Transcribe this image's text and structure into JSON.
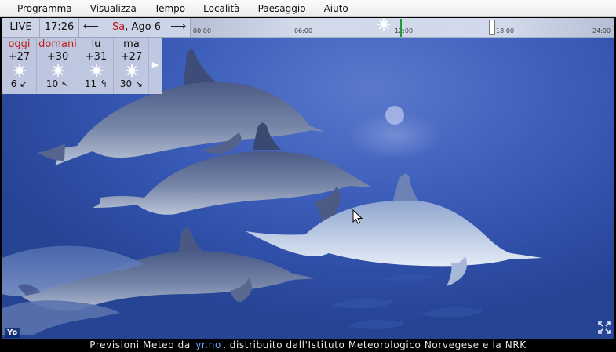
{
  "menu": [
    "Programma",
    "Visualizza",
    "Tempo",
    "Località",
    "Paesaggio",
    "Aiuto"
  ],
  "timebar": {
    "live_label": "LIVE",
    "clock": "17:26",
    "prev_arrow": "⟵",
    "next_arrow": "⟶",
    "day_name": "Sa",
    "date_rest": ", Ago 6",
    "ticks": [
      "00:00",
      "06:00",
      "12:00",
      "18:00",
      "24:00"
    ]
  },
  "forecast": [
    {
      "name": "oggi",
      "temp": "+27",
      "wind": "6 ↙",
      "icon": "sun-icon"
    },
    {
      "name": "domani",
      "temp": "+30",
      "wind": "10 ↖",
      "icon": "sun-icon"
    },
    {
      "name": "lu",
      "temp": "+31",
      "wind": "11 ↰",
      "icon": "sun-icon"
    },
    {
      "name": "ma",
      "temp": "+27",
      "wind": "30 ↘",
      "icon": "sun-icon"
    }
  ],
  "forecast_more": "▶",
  "logo_text": "Yo",
  "footer": {
    "prefix": "Previsioni Meteo da",
    "link": "yr.no",
    "suffix": ", distribuito dall'Istituto Meteorologico Norvegese e la NRK"
  },
  "colors": {
    "water": "#3d5fbb",
    "now_marker": "#1f9b2f",
    "today_red": "#c31a1a",
    "link": "#6fa9ff"
  }
}
